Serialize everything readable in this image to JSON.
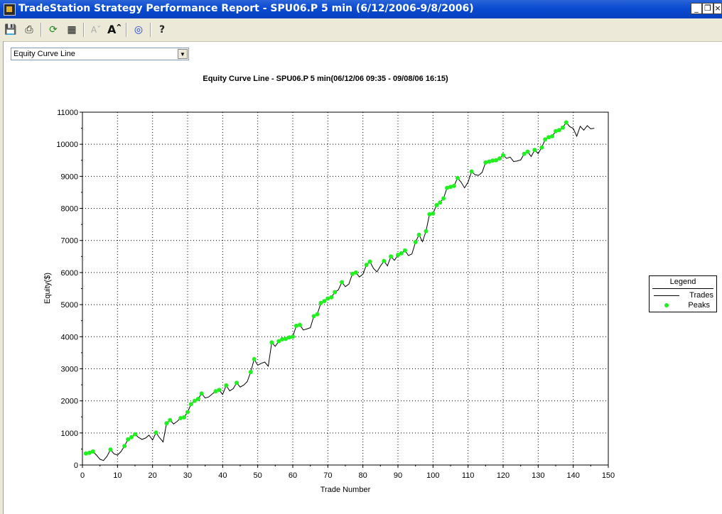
{
  "window": {
    "title": "TradeStation Strategy Performance Report - SPU06.P 5 min (6/12/2006-9/8/2006)"
  },
  "toolbar": {
    "icons": [
      "save-icon",
      "print-icon",
      "refresh-icon",
      "properties-icon",
      "font-smaller-icon",
      "font-larger-icon",
      "target-icon",
      "help-icon"
    ]
  },
  "selector": {
    "value": "Equity Curve Line"
  },
  "legend": {
    "title": "Legend",
    "trades": "Trades",
    "peaks": "Peaks"
  },
  "colors": {
    "peak": "#22ee22",
    "line": "#000000",
    "titlebar": "#0a4bd0"
  },
  "chart_data": {
    "type": "line",
    "title": "Equity Curve Line - SPU06.P 5 min(06/12/06 09:35 - 09/08/06 16:15)",
    "xlabel": "Trade Number",
    "ylabel": "Equity($)",
    "xlim": [
      0,
      150
    ],
    "ylim": [
      0,
      11000
    ],
    "xticks": [
      0,
      10,
      20,
      30,
      40,
      50,
      60,
      70,
      80,
      90,
      100,
      110,
      120,
      130,
      140,
      150
    ],
    "yticks": [
      0,
      1000,
      2000,
      3000,
      4000,
      5000,
      6000,
      7000,
      8000,
      9000,
      10000,
      11000
    ],
    "grid": true,
    "legend_position": "right",
    "series": [
      {
        "name": "Trades",
        "points": [
          [
            1,
            360
          ],
          [
            2,
            380
          ],
          [
            3,
            420
          ],
          [
            4,
            310
          ],
          [
            5,
            180
          ],
          [
            6,
            140
          ],
          [
            7,
            270
          ],
          [
            8,
            480
          ],
          [
            9,
            350
          ],
          [
            10,
            310
          ],
          [
            11,
            420
          ],
          [
            12,
            590
          ],
          [
            13,
            800
          ],
          [
            14,
            870
          ],
          [
            15,
            960
          ],
          [
            16,
            860
          ],
          [
            17,
            800
          ],
          [
            18,
            840
          ],
          [
            19,
            930
          ],
          [
            20,
            780
          ],
          [
            21,
            1010
          ],
          [
            22,
            850
          ],
          [
            23,
            720
          ],
          [
            24,
            1300
          ],
          [
            25,
            1400
          ],
          [
            26,
            1280
          ],
          [
            27,
            1360
          ],
          [
            28,
            1460
          ],
          [
            29,
            1490
          ],
          [
            30,
            1650
          ],
          [
            31,
            1900
          ],
          [
            32,
            2000
          ],
          [
            33,
            2060
          ],
          [
            34,
            2230
          ],
          [
            35,
            2090
          ],
          [
            36,
            2120
          ],
          [
            37,
            2210
          ],
          [
            38,
            2300
          ],
          [
            39,
            2340
          ],
          [
            40,
            2200
          ],
          [
            41,
            2480
          ],
          [
            42,
            2310
          ],
          [
            43,
            2380
          ],
          [
            44,
            2560
          ],
          [
            45,
            2430
          ],
          [
            46,
            2490
          ],
          [
            47,
            2600
          ],
          [
            48,
            2900
          ],
          [
            49,
            3300
          ],
          [
            50,
            3110
          ],
          [
            51,
            3170
          ],
          [
            52,
            3210
          ],
          [
            53,
            3080
          ],
          [
            54,
            3820
          ],
          [
            55,
            3700
          ],
          [
            56,
            3860
          ],
          [
            57,
            3920
          ],
          [
            58,
            3930
          ],
          [
            59,
            3980
          ],
          [
            60,
            4000
          ],
          [
            61,
            4340
          ],
          [
            62,
            4370
          ],
          [
            63,
            4210
          ],
          [
            64,
            4240
          ],
          [
            65,
            4280
          ],
          [
            66,
            4640
          ],
          [
            67,
            4700
          ],
          [
            68,
            5050
          ],
          [
            69,
            5110
          ],
          [
            70,
            5190
          ],
          [
            71,
            5230
          ],
          [
            72,
            5390
          ],
          [
            73,
            5460
          ],
          [
            74,
            5700
          ],
          [
            75,
            5560
          ],
          [
            76,
            5640
          ],
          [
            77,
            5960
          ],
          [
            78,
            6000
          ],
          [
            79,
            5860
          ],
          [
            80,
            5950
          ],
          [
            81,
            6240
          ],
          [
            82,
            6340
          ],
          [
            83,
            6130
          ],
          [
            84,
            6020
          ],
          [
            85,
            6200
          ],
          [
            86,
            6360
          ],
          [
            87,
            6210
          ],
          [
            88,
            6500
          ],
          [
            89,
            6380
          ],
          [
            90,
            6550
          ],
          [
            91,
            6600
          ],
          [
            92,
            6690
          ],
          [
            93,
            6530
          ],
          [
            94,
            6580
          ],
          [
            95,
            6950
          ],
          [
            96,
            7180
          ],
          [
            97,
            6960
          ],
          [
            98,
            7290
          ],
          [
            99,
            7820
          ],
          [
            100,
            7840
          ],
          [
            101,
            8100
          ],
          [
            102,
            8180
          ],
          [
            103,
            8310
          ],
          [
            104,
            8640
          ],
          [
            105,
            8670
          ],
          [
            106,
            8700
          ],
          [
            107,
            8950
          ],
          [
            108,
            8820
          ],
          [
            109,
            8640
          ],
          [
            110,
            8820
          ],
          [
            111,
            9150
          ],
          [
            112,
            9050
          ],
          [
            113,
            9030
          ],
          [
            114,
            9120
          ],
          [
            115,
            9430
          ],
          [
            116,
            9460
          ],
          [
            117,
            9490
          ],
          [
            118,
            9500
          ],
          [
            119,
            9560
          ],
          [
            120,
            9660
          ],
          [
            121,
            9560
          ],
          [
            122,
            9600
          ],
          [
            123,
            9460
          ],
          [
            124,
            9480
          ],
          [
            125,
            9510
          ],
          [
            126,
            9700
          ],
          [
            127,
            9770
          ],
          [
            128,
            9620
          ],
          [
            129,
            9820
          ],
          [
            130,
            9710
          ],
          [
            131,
            9900
          ],
          [
            132,
            10150
          ],
          [
            133,
            10220
          ],
          [
            134,
            10250
          ],
          [
            135,
            10410
          ],
          [
            136,
            10440
          ],
          [
            137,
            10520
          ],
          [
            138,
            10680
          ],
          [
            139,
            10550
          ],
          [
            140,
            10490
          ],
          [
            141,
            10250
          ],
          [
            142,
            10560
          ],
          [
            143,
            10440
          ],
          [
            144,
            10580
          ],
          [
            145,
            10480
          ],
          [
            146,
            10500
          ]
        ]
      },
      {
        "name": "Peaks",
        "points": [
          [
            1,
            360
          ],
          [
            2,
            380
          ],
          [
            3,
            420
          ],
          [
            8,
            480
          ],
          [
            12,
            590
          ],
          [
            13,
            800
          ],
          [
            14,
            870
          ],
          [
            15,
            960
          ],
          [
            21,
            1010
          ],
          [
            24,
            1300
          ],
          [
            25,
            1400
          ],
          [
            28,
            1460
          ],
          [
            29,
            1490
          ],
          [
            30,
            1650
          ],
          [
            31,
            1900
          ],
          [
            32,
            2000
          ],
          [
            33,
            2060
          ],
          [
            34,
            2230
          ],
          [
            38,
            2300
          ],
          [
            39,
            2340
          ],
          [
            41,
            2480
          ],
          [
            44,
            2560
          ],
          [
            48,
            2900
          ],
          [
            49,
            3300
          ],
          [
            54,
            3820
          ],
          [
            56,
            3860
          ],
          [
            57,
            3920
          ],
          [
            58,
            3930
          ],
          [
            59,
            3980
          ],
          [
            60,
            4000
          ],
          [
            61,
            4340
          ],
          [
            62,
            4370
          ],
          [
            66,
            4640
          ],
          [
            67,
            4700
          ],
          [
            68,
            5050
          ],
          [
            69,
            5110
          ],
          [
            70,
            5190
          ],
          [
            71,
            5230
          ],
          [
            72,
            5390
          ],
          [
            74,
            5700
          ],
          [
            77,
            5960
          ],
          [
            78,
            6000
          ],
          [
            81,
            6240
          ],
          [
            82,
            6340
          ],
          [
            86,
            6360
          ],
          [
            88,
            6500
          ],
          [
            90,
            6550
          ],
          [
            91,
            6600
          ],
          [
            92,
            6690
          ],
          [
            95,
            6950
          ],
          [
            96,
            7180
          ],
          [
            98,
            7290
          ],
          [
            99,
            7820
          ],
          [
            100,
            7840
          ],
          [
            101,
            8100
          ],
          [
            102,
            8180
          ],
          [
            103,
            8310
          ],
          [
            104,
            8640
          ],
          [
            105,
            8670
          ],
          [
            106,
            8700
          ],
          [
            107,
            8950
          ],
          [
            111,
            9150
          ],
          [
            115,
            9430
          ],
          [
            116,
            9460
          ],
          [
            117,
            9490
          ],
          [
            118,
            9500
          ],
          [
            119,
            9560
          ],
          [
            120,
            9660
          ],
          [
            126,
            9700
          ],
          [
            127,
            9770
          ],
          [
            129,
            9820
          ],
          [
            131,
            9900
          ],
          [
            132,
            10150
          ],
          [
            133,
            10220
          ],
          [
            134,
            10250
          ],
          [
            135,
            10410
          ],
          [
            136,
            10440
          ],
          [
            137,
            10520
          ],
          [
            138,
            10680
          ]
        ]
      }
    ]
  }
}
